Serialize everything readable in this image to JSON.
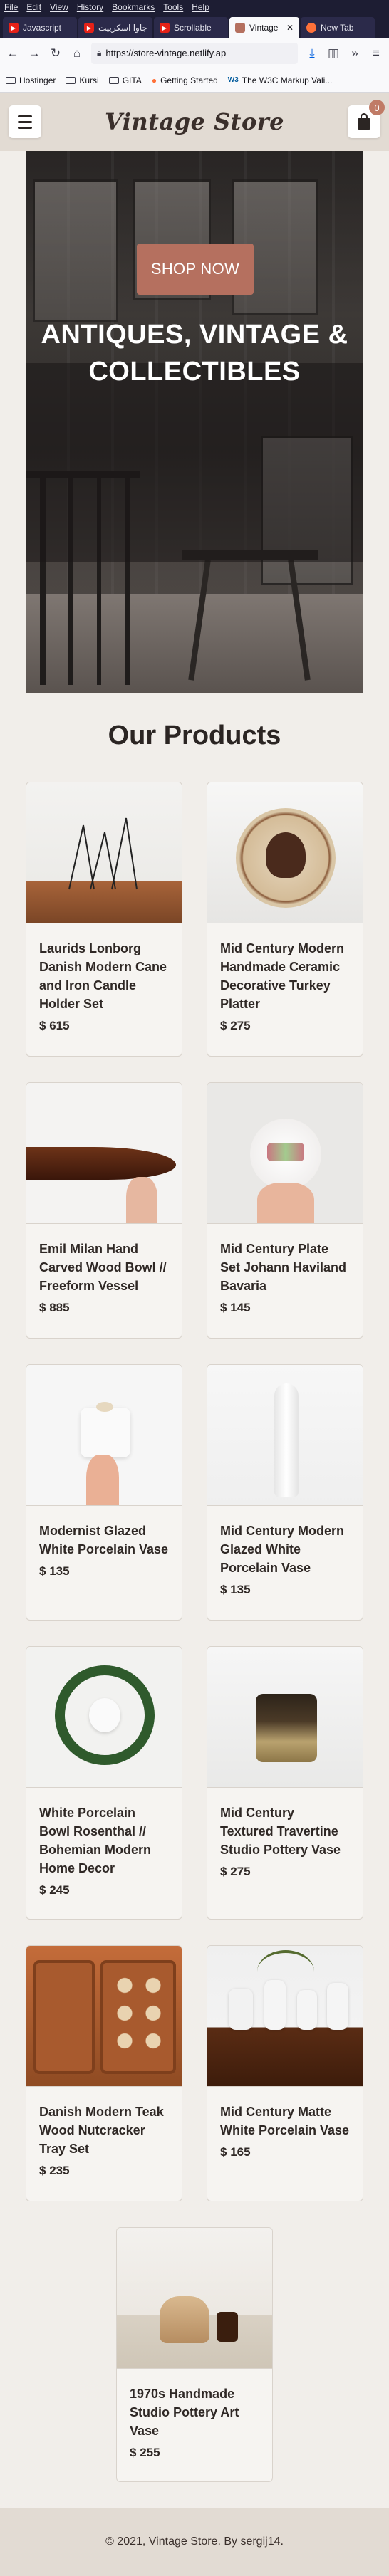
{
  "browser": {
    "menu": [
      "File",
      "Edit",
      "View",
      "History",
      "Bookmarks",
      "Tools",
      "Help"
    ],
    "tabs": [
      {
        "label": "Javascript",
        "icon": "youtube-icon"
      },
      {
        "label": "جاوا اسکریپت",
        "icon": "youtube-icon"
      },
      {
        "label": "Scrollable",
        "icon": "youtube-icon"
      },
      {
        "label": "Vintage",
        "icon": "store-icon",
        "active": true
      },
      {
        "label": "New Tab",
        "icon": "firefox-icon"
      }
    ],
    "url": "https://store-vintage.netlify.ap",
    "bookmarks": [
      "Hostinger",
      "Kursi",
      "GITA",
      "Getting Started",
      "The W3C Markup Vali..."
    ]
  },
  "header": {
    "logo": "Vintage Store",
    "cart_count": "0"
  },
  "hero": {
    "button": "SHOP NOW",
    "title_line1": "ANTIQUES, VINTAGE &",
    "title_line2": "COLLECTIBLES"
  },
  "products": {
    "title": "Our Products",
    "items": [
      {
        "name": "Laurids Lonborg Danish Modern Cane and Iron Candle Holder Set",
        "price": "615"
      },
      {
        "name": "Mid Century Modern Handmade Ceramic Decorative Turkey Platter",
        "price": "275"
      },
      {
        "name": "Emil Milan Hand Carved Wood Bowl // Freeform Vessel",
        "price": "885"
      },
      {
        "name": "Mid Century Plate Set Johann Haviland Bavaria",
        "price": "145"
      },
      {
        "name": "Modernist Glazed White Porcelain Vase",
        "price": "135"
      },
      {
        "name": "Mid Century Modern Glazed White Porcelain Vase",
        "price": "135"
      },
      {
        "name": "White Porcelain Bowl Rosenthal // Bohemian Modern Home Decor",
        "price": "245"
      },
      {
        "name": "Mid Century Textured Travertine Studio Pottery Vase",
        "price": "275"
      },
      {
        "name": "Danish Modern Teak Wood Nutcracker Tray Set",
        "price": "235"
      },
      {
        "name": "Mid Century Matte White Porcelain Vase",
        "price": "165"
      },
      {
        "name": "1970s Handmade Studio Pottery Art Vase",
        "price": "255"
      }
    ]
  },
  "footer": {
    "text": "© 2021, Vintage Store. By sergij14."
  },
  "colors": {
    "accent": "#b5705f",
    "header_bg": "#e2dbd3",
    "page_bg": "#f1eeea"
  }
}
